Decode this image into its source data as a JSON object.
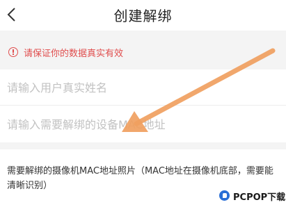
{
  "header": {
    "title": "创建解绑",
    "back_icon": "chevron-left-icon"
  },
  "notice": {
    "text": "请保证你的数据真实有效",
    "icon": "exclamation-circle-icon",
    "color": "#e04d4d"
  },
  "form": {
    "name_placeholder": "请输入用户真实姓名",
    "mac_placeholder": "请输入需要解绑的设备MAC地址"
  },
  "photo_section": {
    "label": "需要解绑的摄像机MAC地址照片（MAC地址在摄像机底部，需要能清晰识别）"
  },
  "annotation": {
    "arrow_color": "#f0a060"
  },
  "watermark": {
    "text": "PCPOP下载"
  }
}
